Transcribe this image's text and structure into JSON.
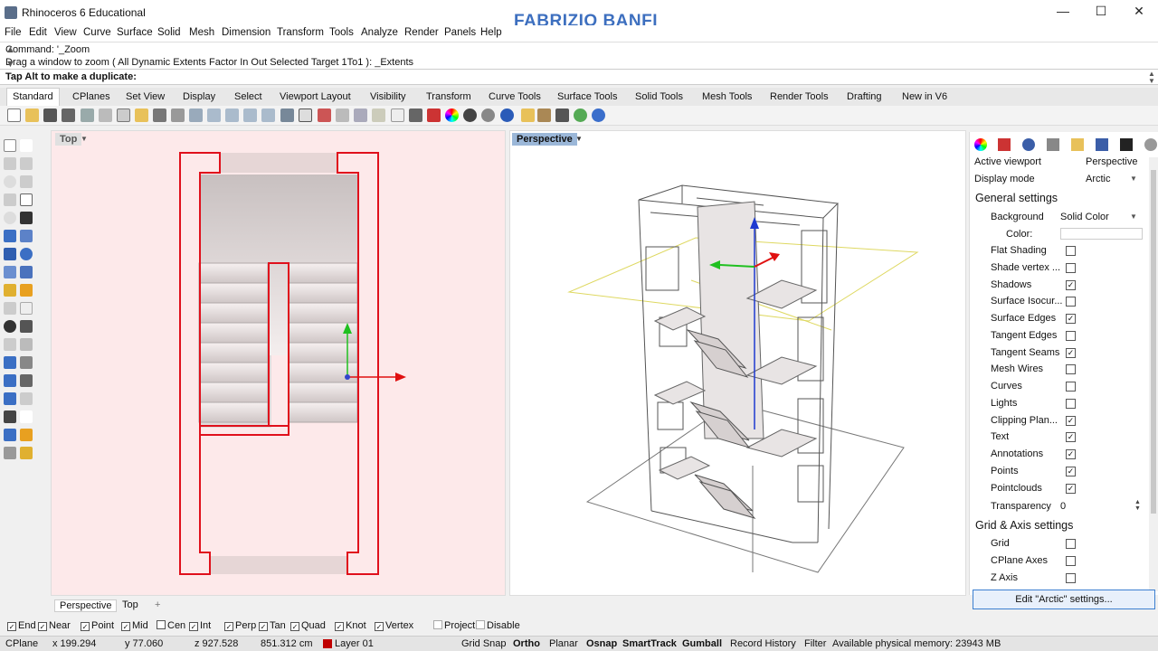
{
  "window": {
    "title": "Rhinoceros 6 Educational",
    "watermark": "FABRIZIO BANFI",
    "minimize": "—",
    "maximize": "☐",
    "close": "✕"
  },
  "menu": [
    "File",
    "Edit",
    "View",
    "Curve",
    "Surface",
    "Solid",
    "Mesh",
    "Dimension",
    "Transform",
    "Tools",
    "Analyze",
    "Render",
    "Panels",
    "Help"
  ],
  "command": {
    "history_1": "Command: '_Zoom",
    "history_2": "Drag a window to zoom ( All  Dynamic  Extents  Factor  In  Out  Selected  Target  1To1 ): _Extents",
    "prompt": "Tap Alt to make a duplicate:"
  },
  "tabs": [
    "Standard",
    "CPlanes",
    "Set View",
    "Display",
    "Select",
    "Viewport Layout",
    "Visibility",
    "Transform",
    "Curve Tools",
    "Surface Tools",
    "Solid Tools",
    "Mesh Tools",
    "Render Tools",
    "Drafting",
    "New in V6"
  ],
  "viewports": {
    "top_label": "Top",
    "persp_label": "Perspective"
  },
  "viewport_tabs": [
    "Perspective",
    "Top",
    "+"
  ],
  "panel": {
    "active_viewport_label": "Active viewport",
    "active_viewport_value": "Perspective",
    "display_mode_label": "Display mode",
    "display_mode_value": "Arctic",
    "general_settings": "General settings",
    "background_label": "Background",
    "background_value": "Solid Color",
    "color_label": "Color:",
    "checks": [
      {
        "label": "Flat Shading",
        "checked": false
      },
      {
        "label": "Shade vertex ...",
        "checked": false
      },
      {
        "label": "Shadows",
        "checked": true
      },
      {
        "label": "Surface Isocur...",
        "checked": false
      },
      {
        "label": "Surface Edges",
        "checked": true
      },
      {
        "label": "Tangent Edges",
        "checked": false
      },
      {
        "label": "Tangent Seams",
        "checked": true
      },
      {
        "label": "Mesh Wires",
        "checked": false
      },
      {
        "label": "Curves",
        "checked": false
      },
      {
        "label": "Lights",
        "checked": false
      },
      {
        "label": "Clipping Plan...",
        "checked": true
      },
      {
        "label": "Text",
        "checked": true
      },
      {
        "label": "Annotations",
        "checked": true
      },
      {
        "label": "Points",
        "checked": true
      },
      {
        "label": "Pointclouds",
        "checked": true
      }
    ],
    "transparency_label": "Transparency",
    "transparency_value": "0",
    "grid_axis_settings": "Grid & Axis settings",
    "grid_checks": [
      {
        "label": "Grid",
        "checked": false
      },
      {
        "label": "CPlane Axes",
        "checked": false
      },
      {
        "label": "Z Axis",
        "checked": false
      }
    ],
    "edit_button": "Edit \"Arctic\" settings..."
  },
  "osnaps": [
    {
      "label": "End",
      "checked": true
    },
    {
      "label": "Near",
      "checked": true
    },
    {
      "label": "Point",
      "checked": true
    },
    {
      "label": "Mid",
      "checked": true
    },
    {
      "label": "Cen",
      "checked": false
    },
    {
      "label": "Int",
      "checked": true
    },
    {
      "label": "Perp",
      "checked": true
    },
    {
      "label": "Tan",
      "checked": true
    },
    {
      "label": "Quad",
      "checked": true
    },
    {
      "label": "Knot",
      "checked": true
    },
    {
      "label": "Vertex",
      "checked": true
    },
    {
      "label": "Project",
      "checked": false
    },
    {
      "label": "Disable",
      "checked": false
    }
  ],
  "status": {
    "cplane": "CPlane",
    "x": "x 199.294",
    "y": "y 77.060",
    "z": "z 927.528",
    "dist": "851.312 cm",
    "layer": "Layer 01",
    "layer_color": "#c00000",
    "grid_snap": "Grid Snap",
    "ortho": "Ortho",
    "planar": "Planar",
    "osnap": "Osnap",
    "smarttrack": "SmartTrack",
    "gumball": "Gumball",
    "record_history": "Record History",
    "filter": "Filter",
    "memory": "Available physical memory: 23943 MB"
  }
}
